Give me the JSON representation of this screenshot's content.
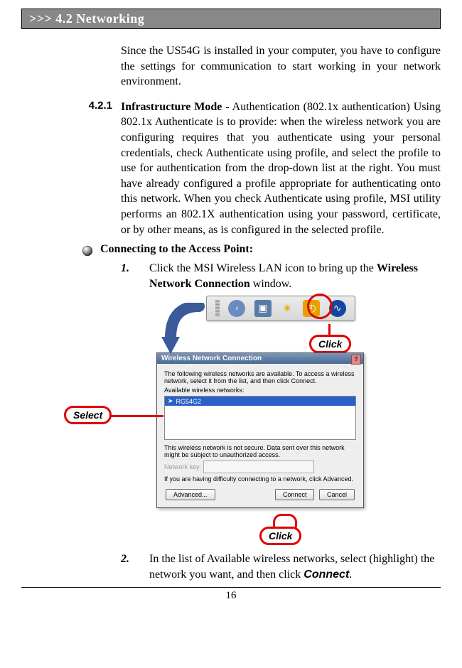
{
  "header": {
    "section_title": ">>> 4.2  Networking"
  },
  "intro": "Since the US54G is installed in your computer, you have to configure the settings for communication to start working in your network environment.",
  "subsection": {
    "number": "4.2.1",
    "text_lead_bold": "Infrastructure Mode",
    "text_rest": " - Authentication (802.1x authentication) Using 802.1x Authenticate is to provide: when the wireless network you are configuring requires that you authenticate using your personal credentials, check Authenticate using profile, and select the profile to use for authentication from the drop-down list at the right.  You must have already configured a profile appropriate for authenticating onto this network.  When you check Authenticate using profile, MSI utility performs an 802.1X authentication using your password, certificate, or by other means, as is configured in the selected profile."
  },
  "bullet_heading": "Connecting to the Access Point:",
  "steps": [
    {
      "num": "1.",
      "pre": "Click the MSI Wireless LAN icon to bring up the ",
      "bold": "Wireless Network Connection",
      "post": " window."
    },
    {
      "num": "2.",
      "pre": "In the list of Available wireless networks, select (highlight) the network you want, and then click ",
      "sans_bold": "Connect",
      "post": "."
    }
  ],
  "callouts": {
    "click": "Click",
    "select": "Select"
  },
  "dialog": {
    "title": "Wireless Network Connection",
    "intro": "The following wireless networks are available. To access a wireless network, select it from the list, and then click Connect.",
    "available_label": "Available wireless networks:",
    "ssid": "RG54G2",
    "warn": "This wireless network is not secure. Data sent over this network might be subject to unauthorized access.",
    "key_label": "Network key:",
    "trouble": "If you are having difficulty connecting to a network, click Advanced.",
    "btn_advanced": "Advanced...",
    "btn_connect": "Connect",
    "btn_cancel": "Cancel"
  },
  "page_number": "16"
}
